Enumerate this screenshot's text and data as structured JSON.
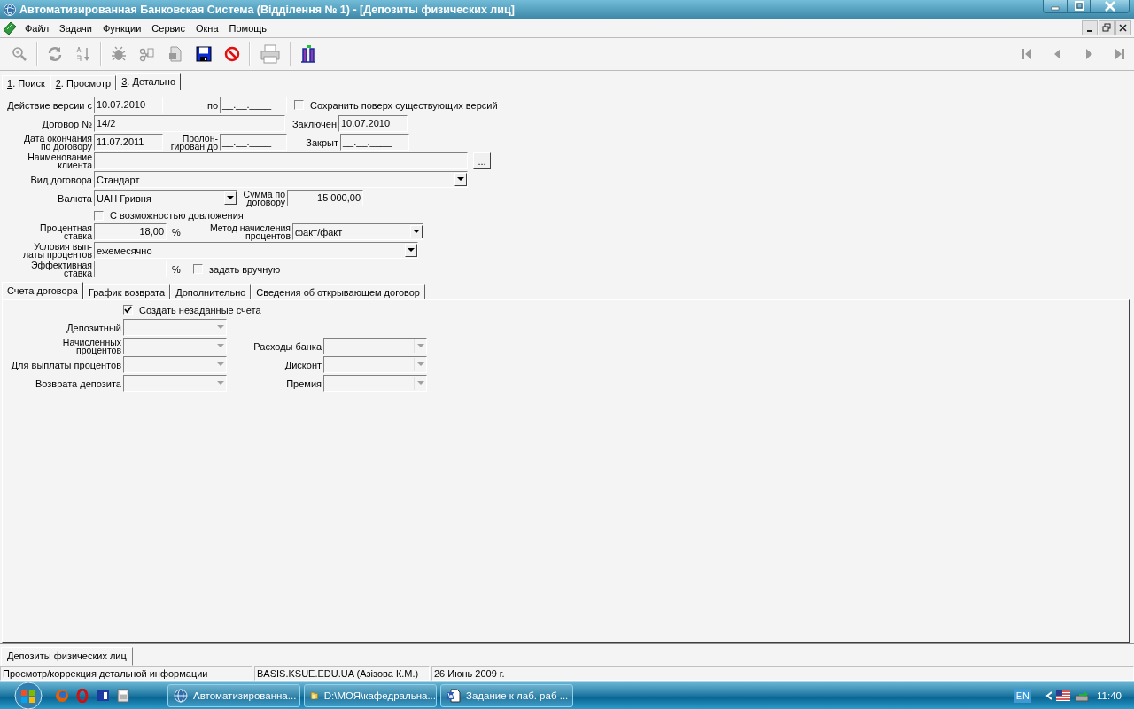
{
  "window": {
    "title": "Автоматизированная Банковская Система (Відділення № 1) - [Депозиты физических лиц]"
  },
  "menu": [
    "Файл",
    "Задачи",
    "Функции",
    "Сервис",
    "Окна",
    "Помощь"
  ],
  "tabs": [
    {
      "label": "1. Поиск",
      "selected": false
    },
    {
      "label": "2. Просмотр",
      "selected": false
    },
    {
      "label": "3. Детально",
      "selected": true
    }
  ],
  "form_rows": [
    {
      "items": [
        {
          "kind": "label",
          "text": "Действие версии с"
        },
        {
          "kind": "field",
          "value": "10.07.2010"
        },
        {
          "kind": "label",
          "text": "по"
        },
        {
          "kind": "field",
          "value": "__.__.____"
        },
        {
          "kind": "checkbox",
          "label": "Сохранить поверх существующих версий",
          "checked": false
        }
      ]
    },
    {
      "items": [
        {
          "kind": "label",
          "text": "Договор №"
        },
        {
          "kind": "field",
          "value": "14/2"
        },
        {
          "kind": "label",
          "text": "Заключен"
        },
        {
          "kind": "field",
          "value": "10.07.2010"
        }
      ]
    },
    {
      "items": [
        {
          "kind": "label",
          "text": "Дата окончания\nпо договору"
        },
        {
          "kind": "field",
          "value": "11.07.2011"
        },
        {
          "kind": "label",
          "text": "Пролон-\nгирован до"
        },
        {
          "kind": "field",
          "value": "__.__.____"
        },
        {
          "kind": "label",
          "text": "Закрыт"
        },
        {
          "kind": "field",
          "value": "__.__.____"
        }
      ]
    },
    {
      "items": [
        {
          "kind": "label",
          "text": "Наименование\nклиента"
        },
        {
          "kind": "field"
        },
        {
          "kind": "button",
          "text": "..."
        }
      ]
    },
    {
      "items": [
        {
          "kind": "label",
          "text": "Вид договора"
        },
        {
          "kind": "combo",
          "value": "Стандарт"
        }
      ]
    },
    {
      "items": [
        {
          "kind": "label",
          "text": "Валюта"
        },
        {
          "kind": "combo",
          "value": "UAH Гривня"
        },
        {
          "kind": "label",
          "text": "Сумма по\nдоговору"
        },
        {
          "kind": "number",
          "value": "15 000,00"
        }
      ]
    },
    {
      "items": [
        {
          "kind": "checkbox",
          "label": "С возможностью довложения",
          "checked": false
        }
      ]
    },
    {
      "items": [
        {
          "kind": "label",
          "text": "Процентная\nставка"
        },
        {
          "kind": "number",
          "value": "18,00"
        },
        {
          "kind": "unit",
          "text": "%"
        },
        {
          "kind": "label",
          "text": "Метод начисления\nпроцентов"
        },
        {
          "kind": "combo",
          "value": "факт/факт"
        }
      ]
    },
    {
      "items": [
        {
          "kind": "label",
          "text": "Условия вып-\nлаты процентов"
        },
        {
          "kind": "combo",
          "value": "ежемесячно"
        }
      ]
    },
    {
      "items": [
        {
          "kind": "label",
          "text": "Эффективная\nставка"
        },
        {
          "kind": "number"
        },
        {
          "kind": "unit",
          "text": "%"
        },
        {
          "kind": "checkbox",
          "label": "задать вручную",
          "checked": false
        }
      ]
    }
  ],
  "account_tabs": [
    {
      "label": "Счета договора",
      "selected": true
    },
    {
      "label": "График возврата",
      "selected": false
    },
    {
      "label": "Дополнительно",
      "selected": false
    },
    {
      "label": "Сведения об открывающем договор",
      "selected": false
    }
  ],
  "create_accounts": {
    "label": "Создать незаданные счета",
    "checked": true
  },
  "account_rows": [
    {
      "left": {
        "label": "Депозитный",
        "disabled": true
      }
    },
    {
      "left": {
        "label": "Начисленных\nпроцентов",
        "disabled": true
      },
      "right": {
        "label": "Расходы банка",
        "disabled": true
      }
    },
    {
      "left": {
        "label": "Для выплаты процентов",
        "disabled": true
      },
      "right": {
        "label": "Дисконт",
        "disabled": true
      }
    },
    {
      "left": {
        "label": "Возврата депозита",
        "disabled": true
      },
      "right": {
        "label": "Премия",
        "disabled": true
      }
    }
  ],
  "document_tabs": [
    {
      "label": "Депозиты физических лиц",
      "selected": true
    }
  ],
  "status_bar": [
    "Просмотр/коррекция детальной информации",
    "BASIS.KSUE.EDU.UA (Азізова К.М.)",
    "26 Июнь 2009 г."
  ],
  "taskbar": {
    "tasks": [
      "Автоматизированна...",
      "D:\\МОЯ\\кафедральна...",
      "Задание к лаб. раб ..."
    ],
    "language": "EN",
    "clock": "11:40"
  }
}
